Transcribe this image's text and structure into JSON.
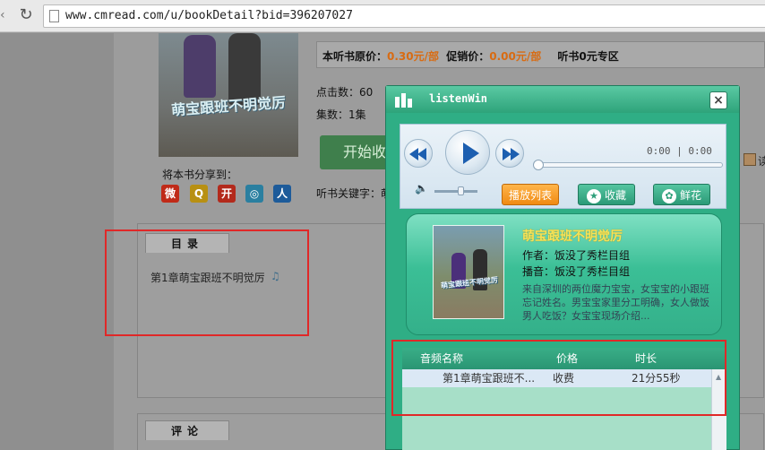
{
  "browser": {
    "url": "www.cmread.com/u/bookDetail?bid=396207027"
  },
  "page": {
    "cover_title": "萌宝跟班不明觉厉",
    "price_label": "本听书原价：",
    "price_value": "0.30元/部",
    "promo_label": "促销价：",
    "promo_value": "0.00元/部",
    "zero_zone": "听书0元专区",
    "clicks": "点击数：60",
    "episodes": "集数：1集",
    "listen_button": "开始收听",
    "share_label": "将本书分享到：",
    "share_icons": [
      {
        "name": "weibo-icon",
        "glyph": "微",
        "color": "#c02a18"
      },
      {
        "name": "qzone-icon",
        "glyph": "Q",
        "color": "#b89013"
      },
      {
        "name": "kaixin-icon",
        "glyph": "开",
        "color": "#b32a1c"
      },
      {
        "name": "tencent-weibo-icon",
        "glyph": "◎",
        "color": "#2a7fa0"
      },
      {
        "name": "renren-icon",
        "glyph": "人",
        "color": "#1d5b9a"
      }
    ],
    "keywords_label": "听书关键字：萌",
    "side_label": "读",
    "toc_tab": "目录",
    "toc_items": [
      "第1章萌宝跟班不明觉厉"
    ],
    "comment_tab": "评论"
  },
  "player": {
    "title": "listenWin",
    "time": "0:00 | 0:00",
    "progress": 0.0,
    "volume": 0.6,
    "buttons": {
      "playlist": "播放列表",
      "favorite": "收藏",
      "flower": "鲜花"
    },
    "book": {
      "title": "萌宝跟班不明觉厉",
      "author": "作者：饭没了秀栏目组",
      "narrator": "播音：饭没了秀栏目组",
      "description": "来自深圳的两位魔力宝宝，女宝宝的小跟班忘记姓名。男宝宝家里分工明确，女人做饭男人吃饭？女宝宝现场介绍..."
    },
    "list": {
      "columns": [
        "音频名称",
        "价格",
        "时长"
      ],
      "rows": [
        {
          "name": "第1章萌宝跟班不...",
          "price": "收费",
          "duration": "21分55秒"
        }
      ]
    }
  },
  "colors": {
    "accent_orange": "#d86b12",
    "player_green": "#2fae85",
    "highlight_red": "#e02828"
  }
}
